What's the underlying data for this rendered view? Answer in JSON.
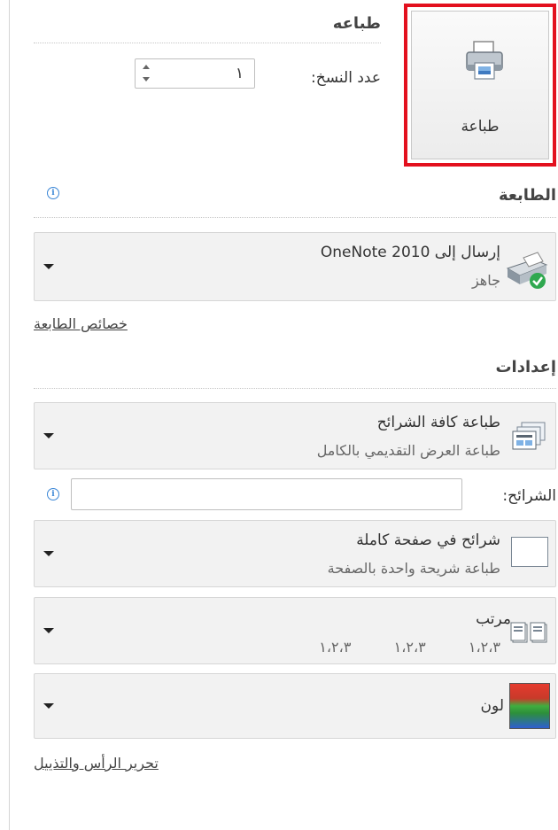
{
  "print": {
    "section_title": "طباعه",
    "button_label": "طباعة",
    "copies_label": "عدد النسخ:",
    "copies_value": "١"
  },
  "printer": {
    "section_title": "الطابعة",
    "name": "إرسال إلى OneNote 2010",
    "status": "جاهز",
    "properties_link": "خصائص الطابعة"
  },
  "settings": {
    "section_title": "إعدادات",
    "slides_range": {
      "title": "طباعة كافة الشرائح",
      "subtitle": "طباعة العرض التقديمي بالكامل"
    },
    "slides_label": "الشرائح:",
    "slides_value": "",
    "layout": {
      "title": "شرائح في صفحة كاملة",
      "subtitle": "طباعة شريحة واحدة بالصفحة"
    },
    "collation": {
      "title": "مرتب",
      "sequence": [
        "١،٢،٣",
        "١،٢،٣",
        "١،٢،٣"
      ]
    },
    "color": {
      "title": "لون"
    },
    "header_footer_link": "تحرير الرأس والتذييل"
  },
  "colors": {
    "highlight": "#e3101e",
    "info": "#3a86d6",
    "ready": "#2fa84f"
  }
}
